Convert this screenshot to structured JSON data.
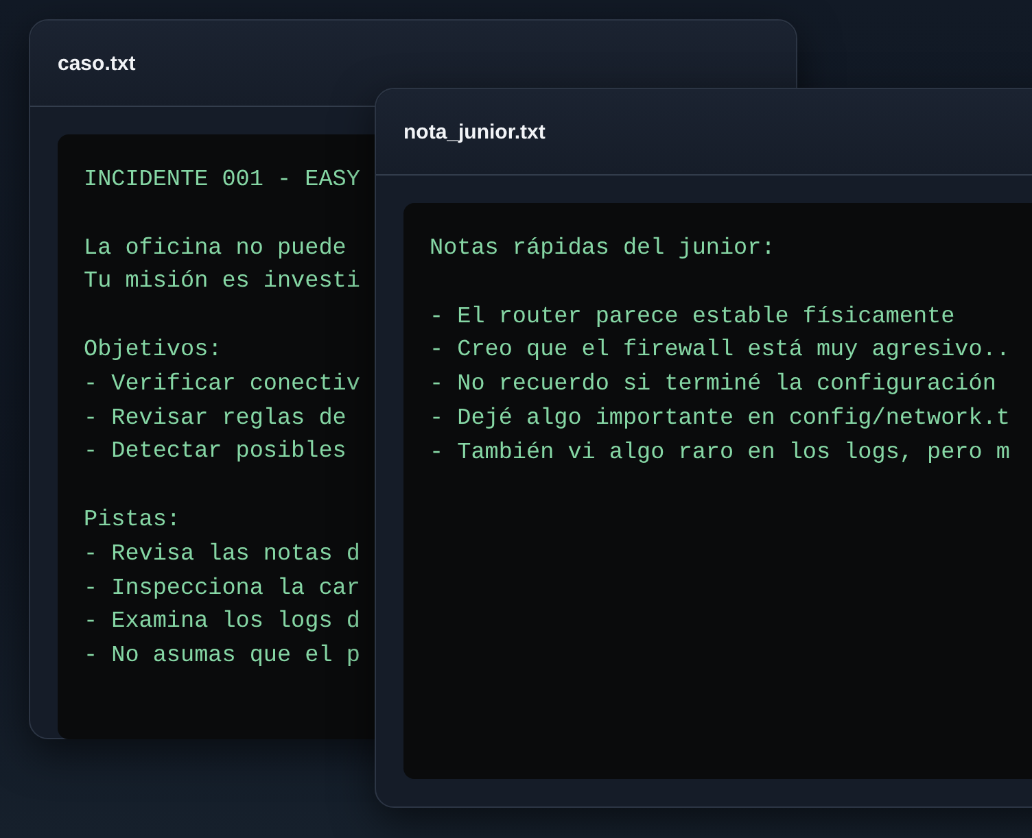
{
  "windows": [
    {
      "title": "caso.txt",
      "paragraphs": [
        [
          "INCIDENTE 001 - EASY"
        ],
        [
          "La oficina no puede",
          "Tu misión es investi"
        ],
        [
          "Objetivos:",
          "- Verificar conectiv",
          "- Revisar reglas de",
          "- Detectar posibles"
        ],
        [
          "Pistas:",
          "- Revisa las notas d",
          "- Inspecciona la car",
          "- Examina los logs d",
          "- No asumas que el p"
        ]
      ]
    },
    {
      "title": "nota_junior.txt",
      "paragraphs": [
        [
          "Notas rápidas del junior:"
        ],
        [
          "- El router parece estable físicamente",
          "- Creo que el firewall está muy agresivo..",
          "- No recuerdo si terminé la configuración",
          "- Dejé algo importante en config/network.t",
          "- También vi algo raro en los logs, pero m"
        ]
      ]
    }
  ]
}
